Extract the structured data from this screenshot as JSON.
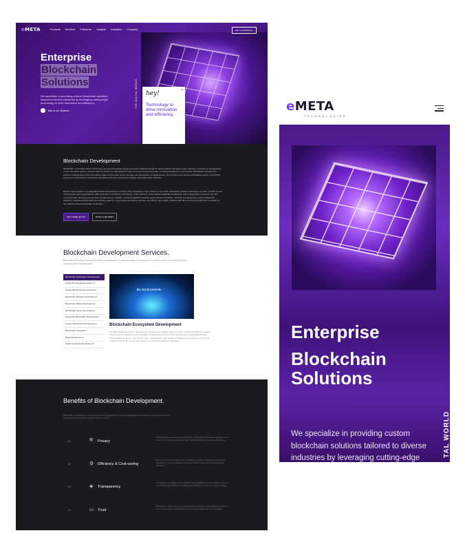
{
  "desktop": {
    "logo": {
      "accent": "e",
      "text": "META"
    },
    "nav": {
      "links": [
        "Products",
        "Services",
        "Enterprise",
        "Insights",
        "Industries",
        "Company"
      ],
      "cta": "GET A PROPOSAL"
    },
    "hero": {
      "title_line1": "Enterprise",
      "title_line2": "Blockchain",
      "title_line3": "Solutions",
      "description": "We specialize in providing custom blockchain solutions tailored to diverse industries by leveraging cutting-edge technology to drive innovation and efficiency.",
      "talk_label": "Talk to our Experts",
      "vertical_label": "THE DIGITAL WORLD",
      "card": {
        "hey": "hey!",
        "text": "Technology to drive innovation and efficiency.",
        "close": "×"
      }
    },
    "development": {
      "heading": "Blockchain Development",
      "paragraph1": "Blockchain is a transformative technology revolutionizing data storage and asset tracking through its decentralized and peer-to-peer networks, secured by cryptography. In this innovative system, all information is stored in a decentralized manner across connected nodes, ensuring transparency and security. Blockchain development involves crafting shared and immutable ledgers that enable secure storage and transactions of digital assets. Performing on an advanced database system, blockchain empowers businesses to streamline information flow and seamlessly integrate data within their networks.",
      "paragraph2": "Emeta Technologies is a leading Blockchain Development Company that specializes in the creation of innovative blockchain solutions tailored to meet the specific needs of businesses and organizations. With expertise in blockchain technology, smart contracts, decentralized applications (DApps), and cryptographic protocols, we offer comprehensive development services to build secure, scalable, and decentralized solutions across various industries. Whether it's developing custom blockchain solutions, integrating blockchain into existing systems, or providing consultancy services, we deliver high-quality solutions that drive business growth and innovation in the rapidly evolving blockchain landscape.",
      "btn_primary": "GET A FREE QUOTE",
      "btn_secondary": "BOOK A LIVE DEMO"
    },
    "services": {
      "heading": "Blockchain Development Services.",
      "subtext": "Blockchain technology and its accompanying applications provide advantages to businesses in various sectors by streamlining and optimizing their collective tasks.",
      "items": [
        "Blockchain Ecosystem Development",
        "Public Blockchain Development",
        "Private Blockchain Development",
        "Blockchain Explorer Development",
        "Blockchain Wallet Development",
        "Blockchain Game Development",
        "Enterprise Blockchain Development",
        "Custom Blockchain Development",
        "Blockchain Integration",
        "Dapp Development",
        "Smart Contracts Development"
      ],
      "image_label": "BLOCKCHAIN",
      "detail_title": "Blockchain Ecosystem Development",
      "detail_desc": "Our Blockchain Ecosystem Development services encompass a diverse array of offerings tailored to various interests and ecosystems. From creating a cryptocurrency that fits the growing and evolving Blockchain-based platforms, forms, tokens, and more meet changes, we provide comprehensive solutions to meet the unique needs of our clients and prosper from the decentralized technology."
    },
    "benefits": {
      "heading": "Benefits of Blockchain Development.",
      "subtext": "Blockchain technology and its accompanying applications provide advantages to businesses in various sectors by streamlining and optimizing their collective tasks.",
      "rows": [
        {
          "num": "01",
          "icon": "⛨",
          "name": "Privacy",
          "desc": "Blockchain ensures data privacy through cryptographic techniques, granting users control over their personal information while still facilitating secure transactions."
        },
        {
          "num": "02",
          "icon": "⚙",
          "name": "Efficiency & Cost-saving",
          "desc": "By removing intermediaries and automating processes, blockchain streamlines operations, reduces transaction times and lowers costs, which boosts overall efficiency."
        },
        {
          "num": "03",
          "icon": "◈",
          "name": "Transparency",
          "desc": "Transactions recorded on the blockchain are transparent and immutable, fostering trust among participants and enabling stakeholders to verify the integrity of data."
        },
        {
          "num": "04",
          "icon": "▭",
          "name": "Trust",
          "desc": "Blockchain instills trust among participants by offering a decentralized and tamper-proof system where transactions are recorded transparently and immutably."
        }
      ]
    }
  },
  "mobile": {
    "logo": {
      "accent": "e",
      "text": "META",
      "sub": "TECHNOLOGIES"
    },
    "hero": {
      "title_line1": "Enterprise",
      "title_line2": "Blockchain Solutions",
      "description": "We specialize in providing custom blockchain solutions tailored to diverse industries by leveraging cutting-edge technology to drive innovation and efficiency.",
      "vertical_label": "TAL WORLD"
    }
  },
  "colors": {
    "brand_purple": "#5a1ea3",
    "dark_bg": "#1b1b1f",
    "accent_violet": "#7a3ff2"
  }
}
